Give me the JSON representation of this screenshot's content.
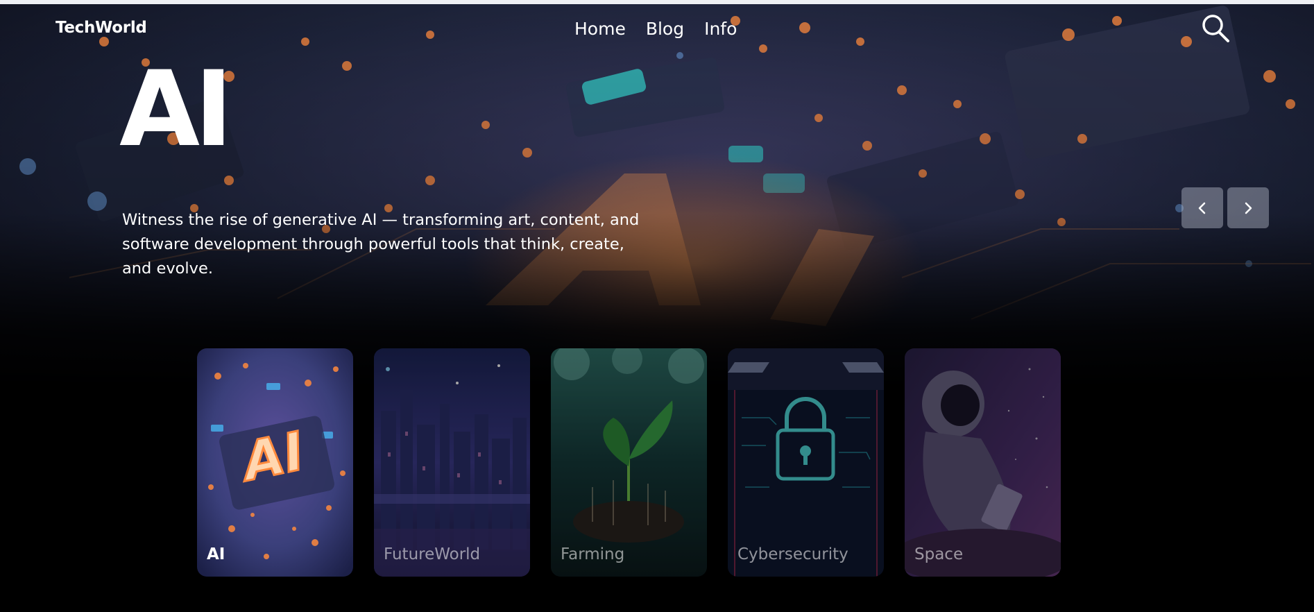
{
  "header": {
    "brand": "TechWorld",
    "nav": [
      "Home",
      "Blog",
      "Info"
    ],
    "search_icon": "search-icon"
  },
  "hero": {
    "title": "AI",
    "description": "Witness the rise of generative AI — transforming art, content, and software development through powerful tools that think, create, and evolve.",
    "background_text": "AI"
  },
  "slider": {
    "prev_icon": "chevron-left-icon",
    "next_icon": "chevron-right-icon"
  },
  "cards": [
    {
      "label": "AI",
      "active": true,
      "art_text": "AI"
    },
    {
      "label": "FutureWorld",
      "active": false
    },
    {
      "label": "Farming",
      "active": false
    },
    {
      "label": "Cybersecurity",
      "active": false
    },
    {
      "label": "Space",
      "active": false
    }
  ],
  "colors": {
    "accent_orange": "#ff8a3d",
    "background": "#000000",
    "text": "#ffffff"
  }
}
